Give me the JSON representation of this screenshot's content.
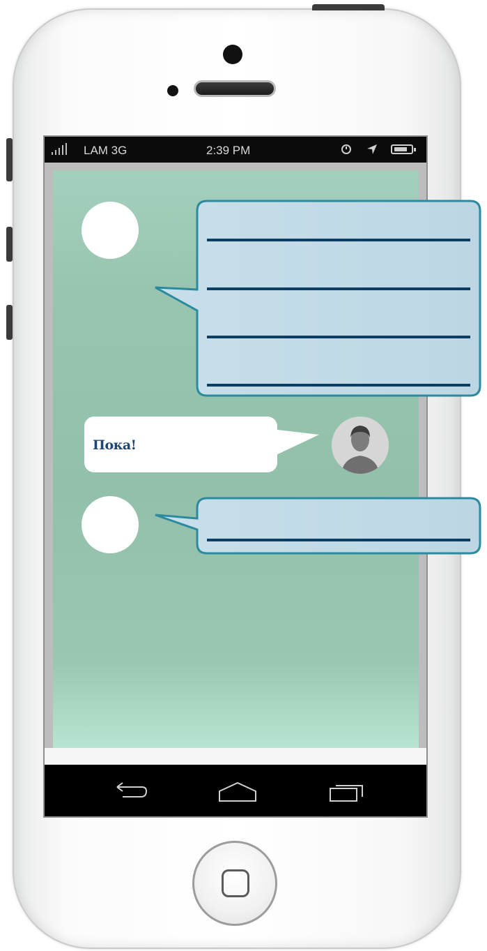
{
  "status_bar": {
    "signal_icon": "signal-bars-icon",
    "carrier": "LAM 3G",
    "time": "2:39 PM",
    "alarm_icon": "alarm-icon",
    "location_icon": "location-arrow-icon",
    "battery_icon": "battery-icon"
  },
  "messages": [
    {
      "side": "incoming",
      "avatar": "blank-avatar-icon",
      "content": "placeholder-lines",
      "line_count": 4
    },
    {
      "side": "outgoing",
      "avatar": "user-avatar-icon",
      "text": "Пока!"
    },
    {
      "side": "incoming",
      "avatar": "blank-avatar-icon",
      "content": "placeholder-lines",
      "line_count": 1
    }
  ],
  "nav_bar": {
    "back_icon": "back-icon",
    "home_icon": "home-icon",
    "recents_icon": "recents-icon"
  },
  "colors": {
    "chat_bg": "#95c2ae",
    "bubble_fill": "#c3dae8",
    "bubble_border": "#2b8a9e",
    "line_color": "#0d3d63",
    "reply_text": "#1f4573"
  }
}
